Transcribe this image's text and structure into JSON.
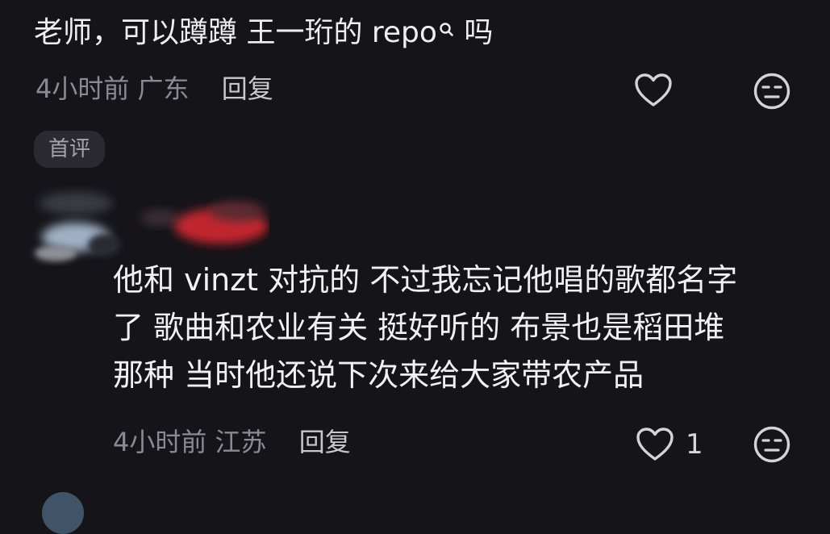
{
  "comment1": {
    "text_before": "老师，可以蹲蹲 王一珩的 repo",
    "text_after": " 吗",
    "search_icon": "search-icon",
    "time": "4小时前",
    "location": "广东",
    "reply_label": "回复",
    "like_icon": "heart-outline-icon",
    "dislike_icon": "neutral-face-icon"
  },
  "badge": {
    "label": "首评"
  },
  "comment2": {
    "lines": [
      "他和 vinzt 对抗的 不过我忘记他唱的歌都名字",
      "了  歌曲和农业有关 挺好听的 布景也是稻田堆",
      "那种 当时他还说下次来给大家带农产品"
    ],
    "time": "4小时前",
    "location": "江苏",
    "reply_label": "回复",
    "like_count": "1",
    "like_icon": "heart-outline-icon",
    "dislike_icon": "neutral-face-icon"
  }
}
